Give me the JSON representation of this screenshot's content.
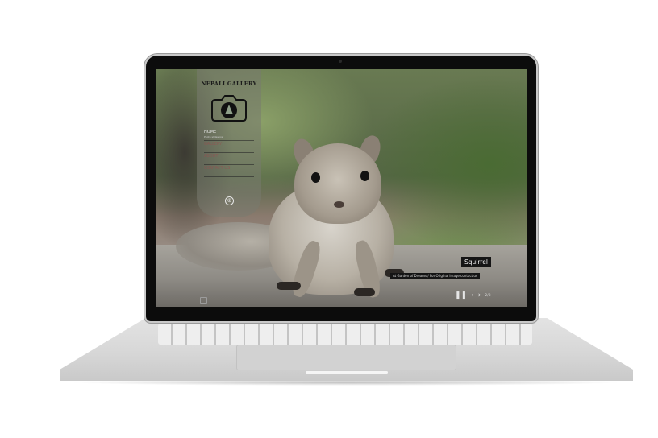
{
  "site": {
    "brand": "NEPALI GALLERY"
  },
  "nav": {
    "items": [
      {
        "label": "HOME",
        "sub": "Photo slideshow"
      },
      {
        "label": "GALLERY"
      },
      {
        "label": "ABOUT"
      },
      {
        "label": "CONTACT US"
      }
    ],
    "toggle_icon": "⊕"
  },
  "slide": {
    "title": "Squirrel",
    "description": "At Garden of Dreams / For Original image contact us",
    "counter": "2/3"
  },
  "controls": {
    "pause_icon": "❚❚",
    "prev_icon": "‹",
    "next_icon": "›"
  },
  "icons": {
    "logo": "camera-icon",
    "toggle": "plus-circle-icon",
    "corner": "fullscreen-icon"
  }
}
